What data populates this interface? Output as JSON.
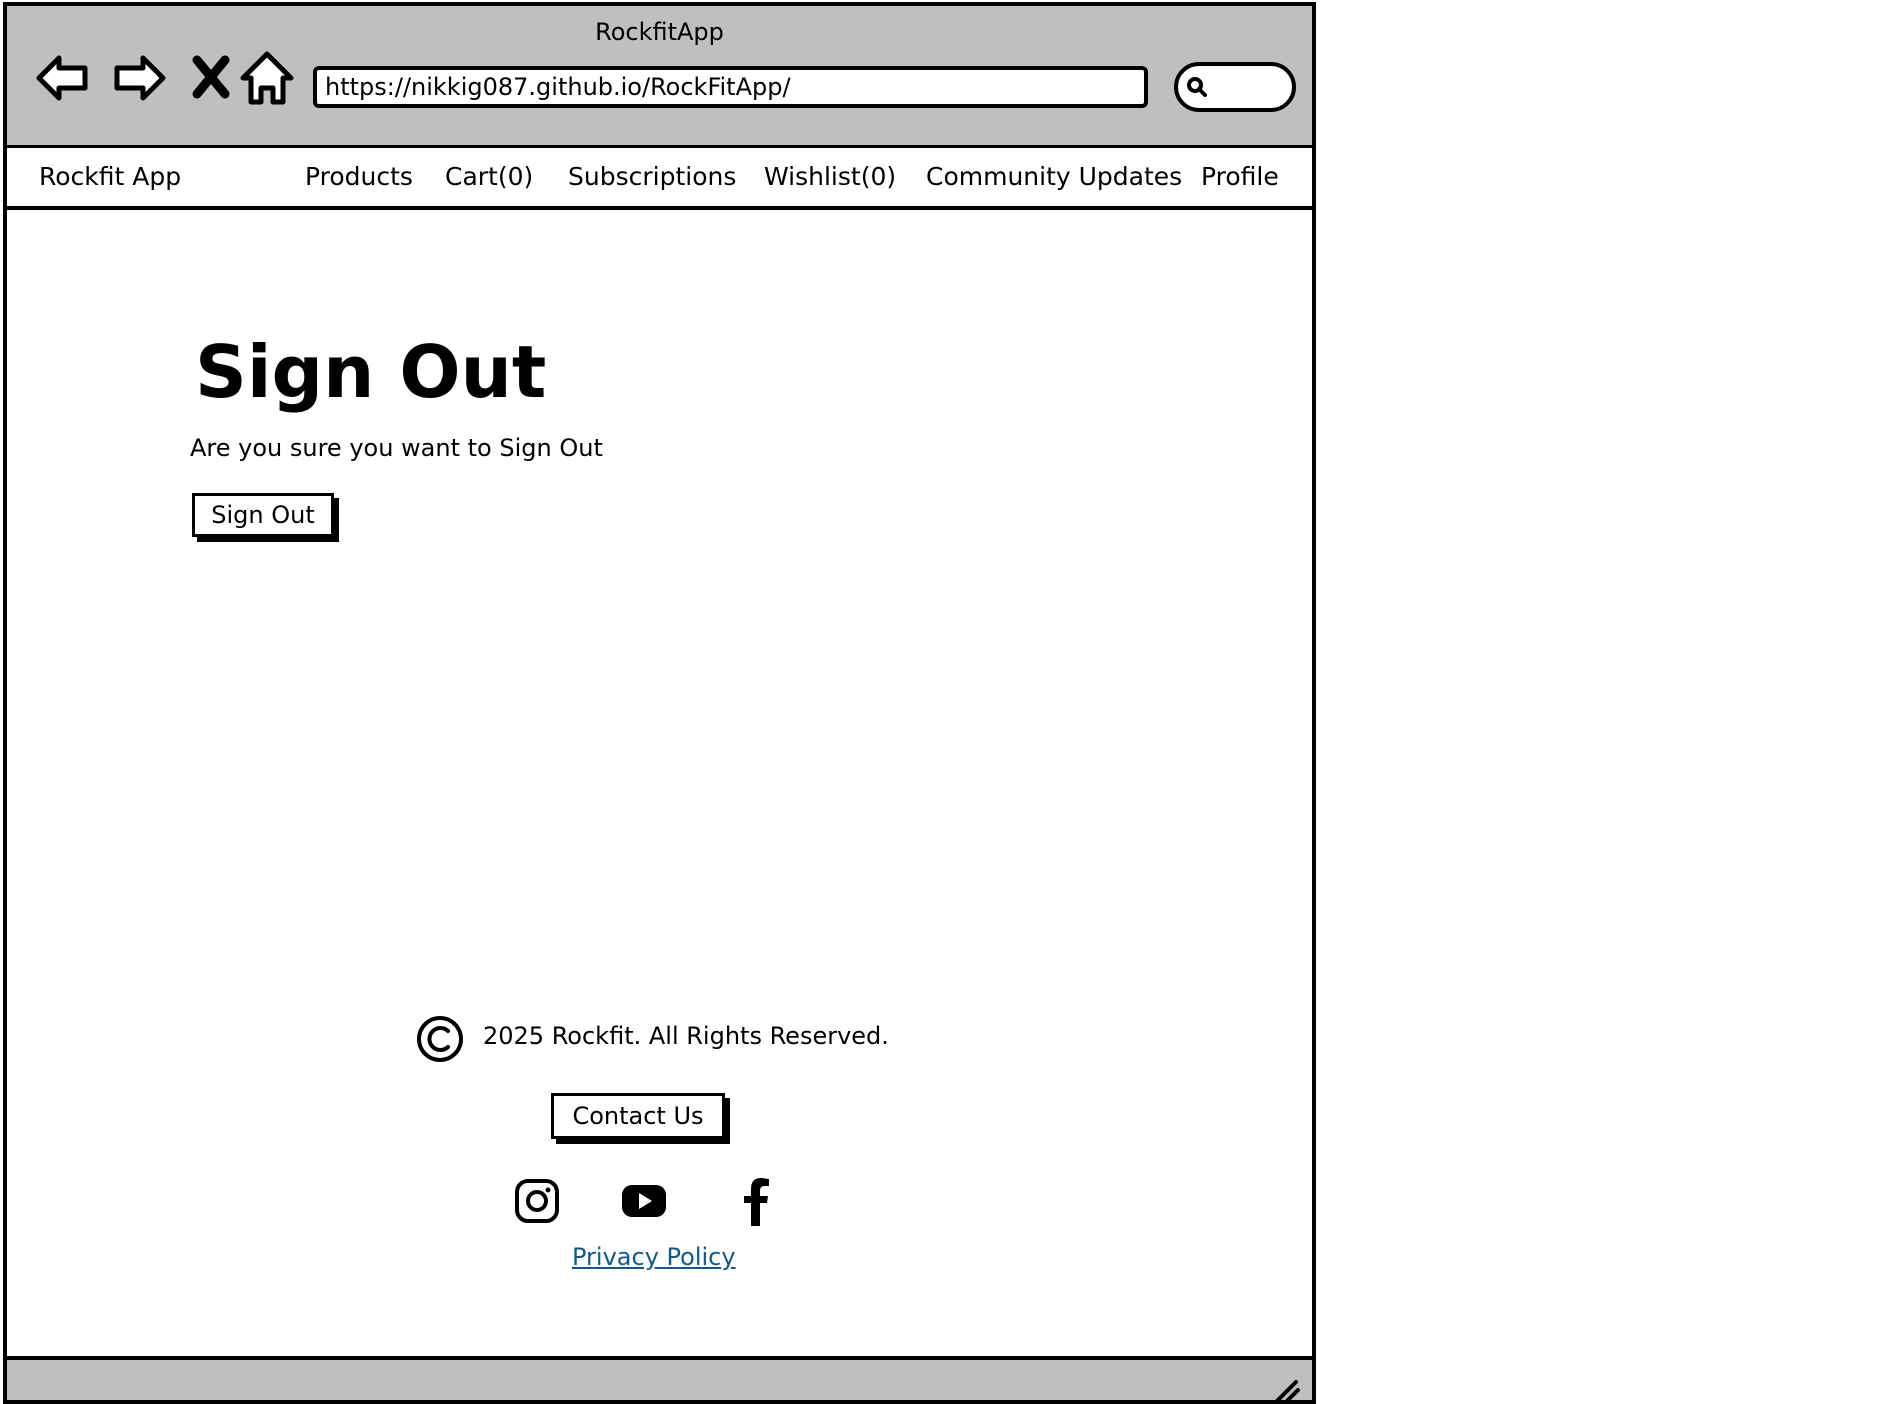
{
  "browser": {
    "window_title": "RockfitApp",
    "url": "https://nikkig087.github.io/RockFitApp/",
    "icons": [
      "back-arrow-icon",
      "forward-arrow-icon",
      "stop-icon",
      "home-icon",
      "search-icon",
      "resize-grip-icon"
    ]
  },
  "nav": {
    "brand": "Rockfit App",
    "links": [
      "Products",
      "Cart(0)",
      "Subscriptions",
      "Wishlist(0)",
      "Community Updates",
      "Profile"
    ]
  },
  "main": {
    "title": "Sign Out",
    "prompt": "Are you sure you want to Sign Out",
    "button_label": "Sign Out"
  },
  "footer": {
    "copyright": "2025 Rockfit. All Rights Reserved.",
    "contact_label": "Contact Us",
    "social": [
      "instagram-icon",
      "youtube-icon",
      "facebook-icon"
    ],
    "privacy_label": "Privacy Policy"
  },
  "colors": {
    "chrome": "#bfbfbf",
    "link": "#0f5a8a"
  }
}
